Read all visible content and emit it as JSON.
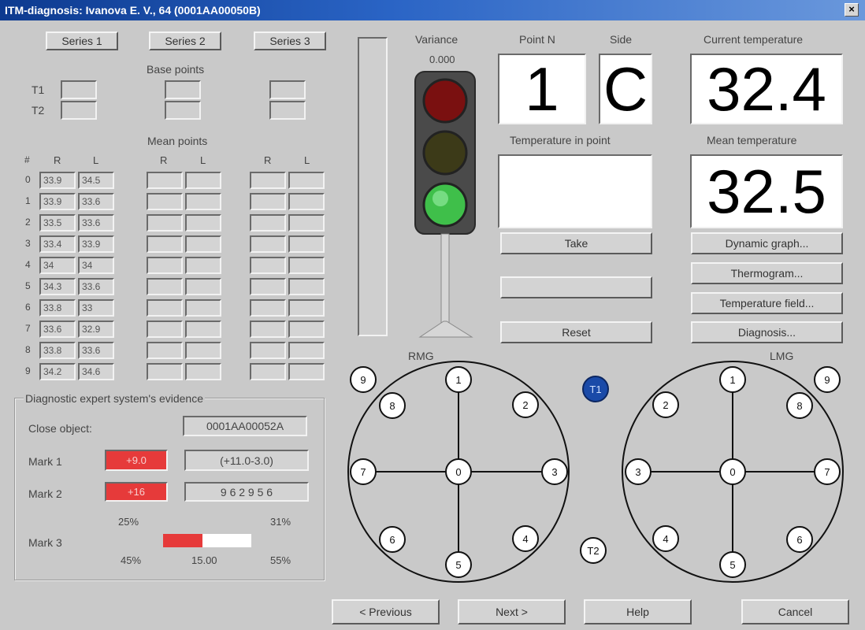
{
  "window": {
    "title": "ITM-diagnosis: Ivanova E. V., 64 (0001AA00050B)",
    "close_glyph": "×"
  },
  "series": {
    "s1": "Series 1",
    "s2": "Series 2",
    "s3": "Series 3"
  },
  "base_points": {
    "label": "Base points",
    "t1": "T1",
    "t2": "T2"
  },
  "mean_points": {
    "label": "Mean points",
    "hash": "#",
    "col_r": "R",
    "col_l": "L",
    "rows": [
      {
        "n": "0",
        "r": "33.9",
        "l": "34.5"
      },
      {
        "n": "1",
        "r": "33.9",
        "l": "33.6"
      },
      {
        "n": "2",
        "r": "33.5",
        "l": "33.6"
      },
      {
        "n": "3",
        "r": "33.4",
        "l": "33.9"
      },
      {
        "n": "4",
        "r": "34",
        "l": "34"
      },
      {
        "n": "5",
        "r": "34.3",
        "l": "33.6"
      },
      {
        "n": "6",
        "r": "33.8",
        "l": "33"
      },
      {
        "n": "7",
        "r": "33.6",
        "l": "32.9"
      },
      {
        "n": "8",
        "r": "33.8",
        "l": "33.6"
      },
      {
        "n": "9",
        "r": "34.2",
        "l": "34.6"
      }
    ]
  },
  "variance": {
    "label": "Variance",
    "value": "0.000"
  },
  "point": {
    "label": "Point N",
    "value": "1",
    "side_label": "Side",
    "side_value": "C"
  },
  "current_temperature": {
    "label": "Current temperature",
    "value": "32.4"
  },
  "temperature_in_point": {
    "label": "Temperature in point",
    "value": ""
  },
  "mean_temperature": {
    "label": "Mean temperature",
    "value": "32.5"
  },
  "buttons": {
    "take": "Take",
    "reset": "Reset",
    "dynamic_graph": "Dynamic graph...",
    "thermogram": "Thermogram...",
    "temperature_field": "Temperature field...",
    "diagnosis": "Diagnosis...",
    "previous": "< Previous",
    "next": "Next >",
    "help": "Help",
    "cancel": "Cancel"
  },
  "evidence": {
    "title": "Diagnostic expert system's evidence",
    "close_object_label": "Close object:",
    "close_object_value": "0001AA00052A",
    "mark1_label": "Mark 1",
    "mark1_value": "+9.0",
    "mark1_range": "(+11.0-3.0)",
    "mark2_label": "Mark 2",
    "mark2_value": "+16",
    "mark2_range": "9 6 2 9 5 6",
    "mark3_label": "Mark 3",
    "mark3_top_left": "25%",
    "mark3_top_right": "31%",
    "mark3_bottom_left": "45%",
    "mark3_bottom_mid": "15.00",
    "mark3_bottom_right": "55%",
    "mark3_fill_fraction": 0.45
  },
  "diagram": {
    "rmg_label": "RMG",
    "lmg_label": "LMG",
    "t1_label": "T1",
    "t2_label": "T2",
    "rmg_points": [
      "0",
      "1",
      "2",
      "3",
      "4",
      "5",
      "6",
      "7",
      "8",
      "9"
    ],
    "lmg_points": [
      "0",
      "1",
      "2",
      "3",
      "4",
      "5",
      "6",
      "7",
      "8",
      "9"
    ]
  },
  "colors": {
    "light_red": "#7a1010",
    "light_yellow": "#3c3a18",
    "light_green": "#3fbf4a",
    "t1_circle": "#1a4aa8",
    "mark_red": "#e63a3a"
  }
}
